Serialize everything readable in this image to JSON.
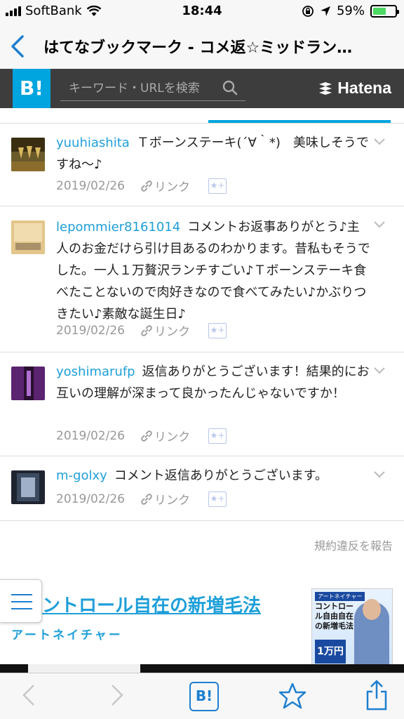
{
  "status_bar": {
    "carrier": "SoftBank",
    "time": "18:44",
    "battery": "59%",
    "battery_level": 0.59
  },
  "nav": {
    "title": "はてなブックマーク - コメ返☆ミッドラン…"
  },
  "header": {
    "logo": "B!",
    "search_placeholder": "キーワード・URLを検索",
    "brand": "Hatena"
  },
  "comments": [
    {
      "user": "yuuhiashita",
      "text": "Ｔボーンステーキ(´∀｀*)　美味しそうですね〜♪",
      "date": "2019/02/26",
      "link": "リンク"
    },
    {
      "user": "lepommier8161014",
      "text": "コメントお返事ありがとう♪主人のお金だけら引け目あるのわかります。昔私もそうでした。一人１万贅沢ランチすごい♪Ｔボーンステーキ食べたことないので肉好きなので食べてみたい♪かぶりつきたい♪素敵な誕生日♪",
      "date": "2019/02/26",
      "link": "リンク"
    },
    {
      "user": "yoshimarufp",
      "text": "返信ありがとうございます！結果的にお互いの理解が深まって良かったんじゃないですか！",
      "date": "2019/02/26",
      "link": "リンク"
    },
    {
      "user": "m-golxy",
      "text": "コメント返信ありがとうございます。",
      "date": "2019/02/26",
      "link": "リンク"
    }
  ],
  "report": "規約違反を報告",
  "ad": {
    "title": "ントロール自在の新増毛法",
    "subtitle": "アートネイチャー",
    "book_tag": "アートネイチャー",
    "book_title": "コントロール自由自在の新増毛法",
    "book_badge": "1万円"
  },
  "colors": {
    "accent": "#00a4de",
    "link": "#1e9fd9",
    "header_bg": "#3d3d3d"
  }
}
